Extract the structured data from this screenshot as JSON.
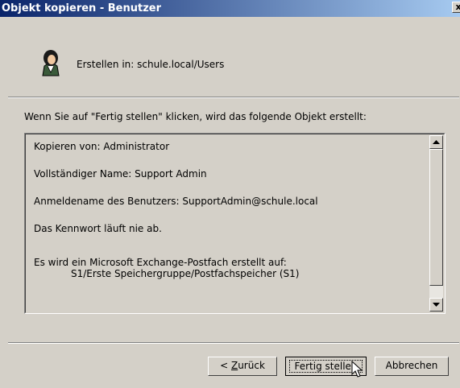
{
  "window": {
    "title": "Objekt kopieren - Benutzer",
    "close_glyph": "x"
  },
  "header": {
    "icon": "user-icon",
    "create_in_label": "Erstellen in:",
    "create_in_value": "schule.local/Users"
  },
  "instruction": "Wenn Sie auf \"Fertig stellen\" klicken, wird das folgende Objekt erstellt:",
  "summary": {
    "lines": [
      "Kopieren von: Administrator",
      "Vollständiger Name: Support Admin",
      "Anmeldename des Benutzers: SupportAdmin@schule.local",
      "Das Kennwort läuft nie ab.",
      "Es wird ein Microsoft Exchange-Postfach erstellt auf:",
      "S1/Erste Speichergruppe/Postfachspeicher (S1)"
    ]
  },
  "buttons": {
    "back": {
      "prefix": "< ",
      "mnemonic": "Z",
      "rest": "urück"
    },
    "finish": "Fertig stellen",
    "cancel": "Abbrechen"
  },
  "colors": {
    "title_start": "#0a246a",
    "title_end": "#a6caf0",
    "face": "#d4d0c8"
  }
}
